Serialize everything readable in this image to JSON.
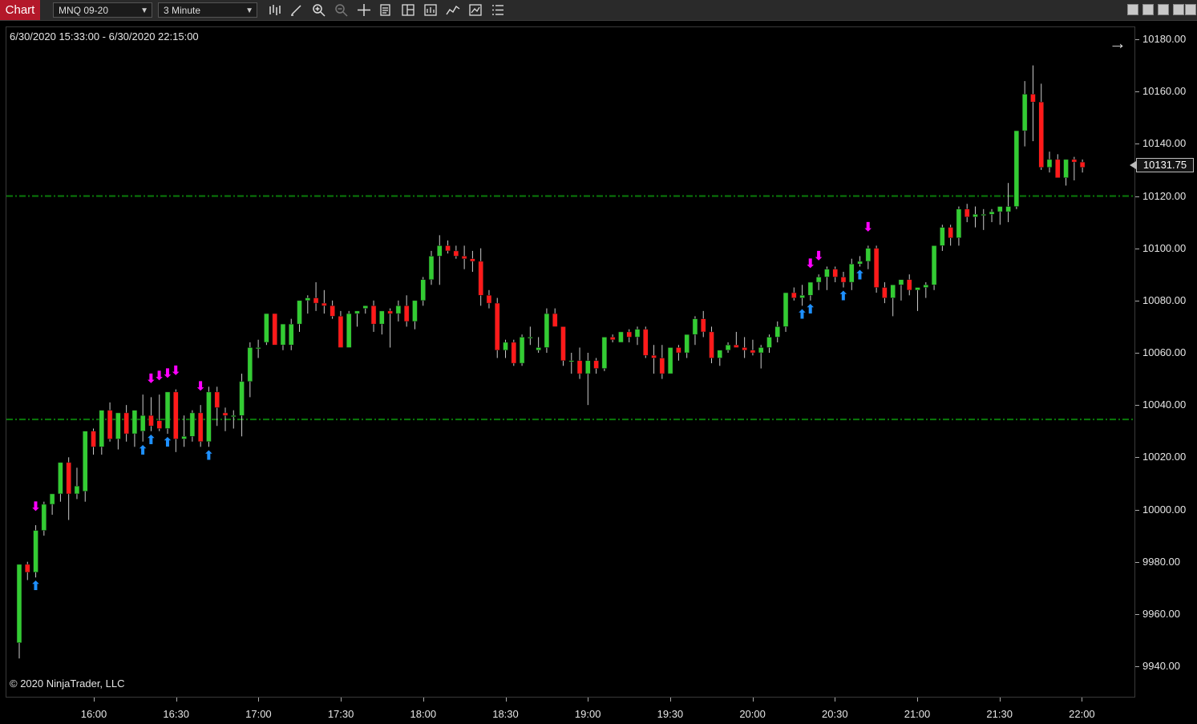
{
  "toolbar": {
    "chart_tab": "Chart",
    "instrument": "MNQ 09-20",
    "interval": "3 Minute",
    "icons": [
      "bar-type-icon",
      "drawing-tool-icon",
      "zoom-in-icon",
      "zoom-out-icon",
      "crosshair-icon",
      "properties-icon",
      "templates-icon",
      "data-box-icon",
      "indicators-icon",
      "strategies-icon",
      "chart-trader-icon"
    ]
  },
  "window_buttons": [
    "minimize-icon",
    "restore-icon",
    "maximize-icon",
    "close-icon"
  ],
  "chart": {
    "range_label": "6/30/2020 15:33:00 - 6/30/2020 22:15:00",
    "copyright": "© 2020 NinjaTrader, LLC",
    "last_price": "10131.75",
    "colors": {
      "up": "#33cc33",
      "down": "#ff1a1a",
      "wick": "#cccccc",
      "line": "#0a7a0a",
      "long_arrow": "#1e90ff",
      "short_arrow": "#ff00ff"
    }
  },
  "chart_data": {
    "type": "candlestick",
    "y_axis_labels": [
      "10180.00",
      "10160.00",
      "10140.00",
      "10120.00",
      "10100.00",
      "10080.00",
      "10060.00",
      "10040.00",
      "10020.00",
      "10000.00",
      "9980.00",
      "9960.00",
      "9940.00"
    ],
    "x_axis_labels": [
      "16:00",
      "16:30",
      "17:00",
      "17:30",
      "18:00",
      "18:30",
      "19:00",
      "19:30",
      "20:00",
      "20:30",
      "21:00",
      "21:30",
      "22:00"
    ],
    "ylim": [
      9930,
      10188
    ],
    "horizontal_lines": [
      10120,
      10034.5
    ],
    "candles": [
      [
        9949,
        9979,
        9943,
        9979
      ],
      [
        9979,
        9980,
        9973,
        9976
      ],
      [
        9976,
        9994,
        9974,
        9992
      ],
      [
        9992,
        10003,
        9990,
        10002
      ],
      [
        10002,
        10006,
        9998,
        10006
      ],
      [
        10006,
        10018,
        10003,
        10018
      ],
      [
        10018,
        10020,
        9996,
        10006
      ],
      [
        10006,
        10016,
        10004,
        10009
      ],
      [
        10007,
        10030,
        10003,
        10030
      ],
      [
        10030,
        10031,
        10021,
        10024
      ],
      [
        10024,
        10038,
        10021,
        10038
      ],
      [
        10038,
        10041,
        10026,
        10027
      ],
      [
        10027,
        10037,
        10023,
        10037
      ],
      [
        10037,
        10040,
        10026,
        10029
      ],
      [
        10029,
        10038,
        10024,
        10038
      ],
      [
        10030,
        10044,
        10026,
        10036
      ],
      [
        10036,
        10043,
        10030,
        10032
      ],
      [
        10034,
        10044,
        10030,
        10031
      ],
      [
        10031,
        10045,
        10029,
        10045
      ],
      [
        10045,
        10046,
        10022,
        10027
      ],
      [
        10027,
        10036,
        10024,
        10028
      ],
      [
        10028,
        10038,
        10026,
        10037
      ],
      [
        10037,
        10040,
        10024,
        10026
      ],
      [
        10026,
        10047,
        10024,
        10045
      ],
      [
        10045,
        10047,
        10032,
        10039
      ],
      [
        10037,
        10039,
        10030,
        10036
      ],
      [
        10036,
        10038,
        10031,
        10036
      ],
      [
        10036,
        10052,
        10028,
        10049
      ],
      [
        10049,
        10064,
        10043,
        10062
      ],
      [
        10062,
        10065,
        10058,
        10062
      ],
      [
        10064,
        10075,
        10063,
        10075
      ],
      [
        10075,
        10075,
        10063,
        10063
      ],
      [
        10063,
        10071,
        10061,
        10071
      ],
      [
        10063,
        10073,
        10061,
        10071
      ],
      [
        10071,
        10080,
        10068,
        10080
      ],
      [
        10080,
        10082,
        10075,
        10081
      ],
      [
        10081,
        10087,
        10076,
        10079
      ],
      [
        10079,
        10084,
        10075,
        10078
      ],
      [
        10078,
        10080,
        10073,
        10074
      ],
      [
        10074,
        10076,
        10062,
        10062
      ],
      [
        10062,
        10076,
        10062,
        10075
      ],
      [
        10075,
        10076,
        10070,
        10076
      ],
      [
        10077,
        10078,
        10075,
        10078
      ],
      [
        10078,
        10080,
        10068,
        10071
      ],
      [
        10071,
        10076,
        10067,
        10076
      ],
      [
        10076,
        10077,
        10062,
        10075
      ],
      [
        10075,
        10080,
        10072,
        10078
      ],
      [
        10078,
        10082,
        10070,
        10072
      ],
      [
        10072,
        10080,
        10069,
        10080
      ],
      [
        10080,
        10089,
        10078,
        10088
      ],
      [
        10088,
        10099,
        10086,
        10097
      ],
      [
        10097,
        10105,
        10086,
        10101
      ],
      [
        10101,
        10103,
        10098,
        10099
      ],
      [
        10099,
        10101,
        10096,
        10097
      ],
      [
        10097,
        10101,
        10092,
        10096
      ],
      [
        10096,
        10099,
        10091,
        10095
      ],
      [
        10095,
        10100,
        10078,
        10082
      ],
      [
        10082,
        10084,
        10077,
        10079
      ],
      [
        10079,
        10081,
        10058,
        10061
      ],
      [
        10061,
        10065,
        10058,
        10064
      ],
      [
        10064,
        10065,
        10055,
        10056
      ],
      [
        10056,
        10067,
        10055,
        10066
      ],
      [
        10066,
        10070,
        10063,
        10066
      ],
      [
        10061,
        10066,
        10060,
        10062
      ],
      [
        10062,
        10077,
        10060,
        10075
      ],
      [
        10075,
        10077,
        10070,
        10070
      ],
      [
        10070,
        10070,
        10055,
        10057
      ],
      [
        10057,
        10060,
        10052,
        10057
      ],
      [
        10057,
        10062,
        10050,
        10052
      ],
      [
        10052,
        10060,
        10040,
        10057
      ],
      [
        10057,
        10058,
        10052,
        10054
      ],
      [
        10054,
        10066,
        10053,
        10066
      ],
      [
        10066,
        10067,
        10064,
        10065
      ],
      [
        10064,
        10068,
        10064,
        10068
      ],
      [
        10068,
        10069,
        10064,
        10066
      ],
      [
        10066,
        10070,
        10063,
        10069
      ],
      [
        10069,
        10070,
        10058,
        10059
      ],
      [
        10059,
        10063,
        10052,
        10058
      ],
      [
        10058,
        10063,
        10050,
        10052
      ],
      [
        10052,
        10062,
        10052,
        10062
      ],
      [
        10062,
        10063,
        10057,
        10060
      ],
      [
        10060,
        10067,
        10058,
        10067
      ],
      [
        10067,
        10074,
        10063,
        10073
      ],
      [
        10073,
        10076,
        10066,
        10068
      ],
      [
        10068,
        10070,
        10056,
        10058
      ],
      [
        10058,
        10061,
        10055,
        10061
      ],
      [
        10061,
        10064,
        10060,
        10063
      ],
      [
        10063,
        10068,
        10062,
        10062
      ],
      [
        10062,
        10066,
        10058,
        10061
      ],
      [
        10061,
        10065,
        10059,
        10060
      ],
      [
        10060,
        10063,
        10054,
        10062
      ],
      [
        10062,
        10067,
        10060,
        10066
      ],
      [
        10066,
        10072,
        10064,
        10070
      ],
      [
        10070,
        10083,
        10068,
        10083
      ],
      [
        10083,
        10085,
        10080,
        10081
      ],
      [
        10081,
        10086,
        10078,
        10082
      ],
      [
        10082,
        10087,
        10080,
        10087
      ],
      [
        10087,
        10090,
        10084,
        10089
      ],
      [
        10089,
        10093,
        10084,
        10092
      ],
      [
        10092,
        10093,
        10087,
        10089
      ],
      [
        10089,
        10091,
        10085,
        10087
      ],
      [
        10087,
        10096,
        10084,
        10094
      ],
      [
        10094,
        10097,
        10093,
        10095
      ],
      [
        10095,
        10101,
        10092,
        10100
      ],
      [
        10100,
        10101,
        10083,
        10085
      ],
      [
        10085,
        10087,
        10079,
        10081
      ],
      [
        10081,
        10086,
        10074,
        10086
      ],
      [
        10086,
        10088,
        10080,
        10088
      ],
      [
        10088,
        10090,
        10082,
        10084
      ],
      [
        10084,
        10085,
        10076,
        10085
      ],
      [
        10085,
        10087,
        10081,
        10086
      ],
      [
        10086,
        10101,
        10084,
        10101
      ],
      [
        10101,
        10109,
        10099,
        10108
      ],
      [
        10108,
        10109,
        10101,
        10104
      ],
      [
        10104,
        10116,
        10101,
        10115
      ],
      [
        10115,
        10117,
        10110,
        10112
      ],
      [
        10112,
        10116,
        10108,
        10113
      ],
      [
        10113,
        10115,
        10107,
        10113
      ],
      [
        10113,
        10115,
        10110,
        10114
      ],
      [
        10114,
        10116,
        10109,
        10116
      ],
      [
        10114,
        10125,
        10110,
        10116
      ],
      [
        10116,
        10145,
        10115,
        10145
      ],
      [
        10145,
        10164,
        10139,
        10159
      ],
      [
        10159,
        10170,
        10141,
        10156
      ],
      [
        10156,
        10163,
        10130,
        10131
      ],
      [
        10131,
        10137,
        10129,
        10134
      ],
      [
        10134,
        10136,
        10127,
        10127
      ],
      [
        10127,
        10134,
        10124,
        10134
      ],
      [
        10134,
        10135,
        10126,
        10133
      ],
      [
        10133,
        10134,
        10129,
        10131
      ]
    ]
  }
}
